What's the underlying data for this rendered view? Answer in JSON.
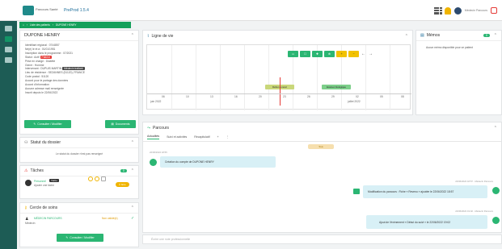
{
  "topbar": {
    "logo_text": "Parcours Santé",
    "app_title": "PreProd 1.5.4",
    "user_name": "Médecin Parcours"
  },
  "breadcrumb": {
    "items": [
      "Liste des patients",
      "DUPONE HENRY"
    ]
  },
  "patient": {
    "name": "DUPONE HENRY",
    "lines": [
      "Identifiant régional : 0744857",
      "Né(e) le et à : 01/01/1951",
      "Inscription dans le programme : 07/2021",
      "Statut : Actif",
      "Prise en charge : Diabète",
      "Genre : Homme",
      "Intervenant : DUPUIS MARTIN",
      "Lieu de résidence : SEZANNES (51120), FRANCE",
      "Code postal : 51120",
      "Accord pour le partage des données",
      "Accord d'information",
      "Aucune adresse mail renseignée",
      "Inscrit depuis le 22/06/2022"
    ],
    "status_pill": "Patient",
    "dark_pill": "Médecin traitant",
    "consult_button": "Consulter / Modifier",
    "docs_button": "Documents"
  },
  "dossier_status": {
    "title": "Statut du dossier",
    "text": "Le statut du dossier n'est pas renseigné"
  },
  "tasks": {
    "title": "Tâches",
    "badge": "0",
    "assignee_role": "Personnel",
    "assignee_sub": "Ajouter une tâche",
    "tag": "Tâche",
    "status_badge": "À faire"
  },
  "care_circle": {
    "title": "Cercle de soins",
    "member_name": "MÉDECIN PARCOURS",
    "member_role": "Médecin",
    "member_status": "Non validé(e)",
    "button": "Consulter / Modifier"
  },
  "timeline": {
    "title": "Ligne de vie",
    "buttons": [
      "Brouillon",
      "Rendez-vous",
      "Hospitalisation",
      "Examen",
      "Zoom +",
      "Zoom -"
    ],
    "ticks": [
      "06",
      "10",
      "13",
      "16",
      "20",
      "23",
      "26",
      "29",
      "02",
      "05",
      "08"
    ],
    "month_left": "juin 2022",
    "month_right": "juillet 2022",
    "events": [
      "Début du suivi",
      "Examen biologique"
    ]
  },
  "memos": {
    "title": "Mémos",
    "badge": "0",
    "empty_text": "Aucun mémo disponible pour ce patient"
  },
  "parcours": {
    "title": "Parcours",
    "tabs": [
      "Actualités",
      "Suivi et activités",
      "Récapitulatif"
    ],
    "stage_pill": "Tous",
    "messages": [
      {
        "meta": "22/06/2022 18:55",
        "text": "Création du compte de DUPONE HENRY",
        "side": "left"
      },
      {
        "meta": "22/06/2022 18:57 - Médecin Parcours",
        "text": "Modification du parcours : Fiche « Revenu » ajoutée le 22/06/2022 18:57",
        "side": "right"
      },
      {
        "meta": "22/06/2022 19:02 - Médecin Parcours",
        "text": "Ajout de l'événement « Début du suivi » le 22/06/2022 19:02",
        "side": "right"
      }
    ],
    "compose_placeholder": "Écrire une note professionnelle"
  }
}
